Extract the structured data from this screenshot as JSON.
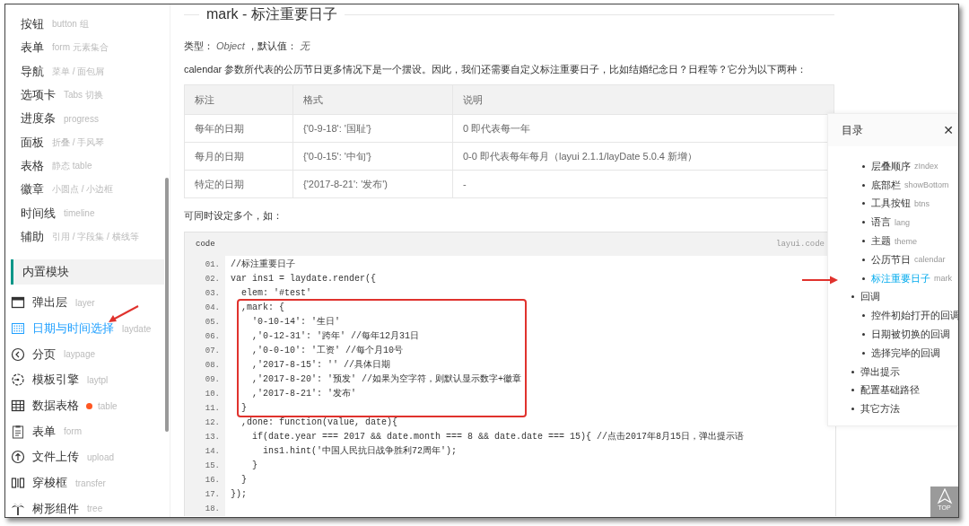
{
  "sidebar": {
    "items": [
      {
        "label": "按钮",
        "hint": "button 组",
        "selected": false
      },
      {
        "label": "表单",
        "hint": "form 元素集合",
        "selected": false
      },
      {
        "label": "导航",
        "hint": "菜单 / 面包屑",
        "selected": false
      },
      {
        "label": "选项卡",
        "hint": "Tabs 切换",
        "selected": false
      },
      {
        "label": "进度条",
        "hint": "progress",
        "selected": false
      },
      {
        "label": "面板",
        "hint": "折叠 / 手风琴",
        "selected": false
      },
      {
        "label": "表格",
        "hint": "静态 table",
        "selected": false
      },
      {
        "label": "徽章",
        "hint": "小圆点 / 小边框",
        "selected": false
      },
      {
        "label": "时间线",
        "hint": "timeline",
        "selected": false
      },
      {
        "label": "辅助",
        "hint": "引用 / 字段集 / 横线等",
        "selected": false
      }
    ],
    "section": "内置模块",
    "modules": [
      {
        "label": "弹出层",
        "hint": "layer",
        "selected": false,
        "badge": false
      },
      {
        "label": "日期与时间选择",
        "hint": "laydate",
        "selected": true,
        "badge": false
      },
      {
        "label": "分页",
        "hint": "laypage",
        "selected": false,
        "badge": false
      },
      {
        "label": "模板引擎",
        "hint": "laytpl",
        "selected": false,
        "badge": false
      },
      {
        "label": "数据表格",
        "hint": "table",
        "selected": false,
        "badge": true
      },
      {
        "label": "表单",
        "hint": "form",
        "selected": false,
        "badge": false
      },
      {
        "label": "文件上传",
        "hint": "upload",
        "selected": false,
        "badge": false
      },
      {
        "label": "穿梭框",
        "hint": "transfer",
        "selected": false,
        "badge": false
      },
      {
        "label": "树形组件",
        "hint": "tree",
        "selected": false,
        "badge": false
      }
    ]
  },
  "content": {
    "title": "mark - 标注重要日子",
    "type_label": "类型：",
    "type_value": "Object",
    "default_label": "，默认值：",
    "default_value": "无",
    "intro": "calendar 参数所代表的公历节日更多情况下是一个摆设。因此，我们还需要自定义标注重要日子，比如结婚纪念日？日程等？它分为以下两种：",
    "table": {
      "columns": [
        "标注",
        "格式",
        "说明"
      ],
      "rows": [
        [
          "每年的日期",
          "{'0-9-18': '国耻'}",
          "0 即代表每一年"
        ],
        [
          "每月的日期",
          "{'0-0-15': '中旬'}",
          "0-0 即代表每年每月（layui 2.1.1/layDate 5.0.4 新增）"
        ],
        [
          "特定的日期",
          "{'2017-8-21': '发布')",
          "-"
        ]
      ]
    },
    "note": "可同时设定多个，如：",
    "code": {
      "label": "code",
      "brand": "layui.code",
      "blocks": [
        {
          "boxed": false,
          "lines": [
            {
              "no": "01.",
              "text": "//标注重要日子"
            },
            {
              "no": "02.",
              "text": "var ins1 = laydate.render({"
            },
            {
              "no": "03.",
              "text": "  elem: '#test'"
            }
          ]
        },
        {
          "boxed": true,
          "lines": [
            {
              "no": "04.",
              "text": "  ,mark: {"
            },
            {
              "no": "05.",
              "text": "    '0-10-14': '生日'"
            },
            {
              "no": "06.",
              "text": "    ,'0-12-31': '跨年' //每年12月31日"
            },
            {
              "no": "07.",
              "text": "    ,'0-0-10': '工资' //每个月10号"
            },
            {
              "no": "08.",
              "text": "    ,'2017-8-15': '' //具体日期"
            },
            {
              "no": "09.",
              "text": "    ,'2017-8-20': '预发' //如果为空字符，则默认显示数字+徽章"
            },
            {
              "no": "10.",
              "text": "    ,'2017-8-21': '发布'"
            },
            {
              "no": "11.",
              "text": "  }"
            }
          ]
        },
        {
          "boxed": false,
          "lines": [
            {
              "no": "12.",
              "text": "  ,done: function(value, date){"
            },
            {
              "no": "13.",
              "text": "    if(date.year === 2017 && date.month === 8 && date.date === 15){ //点击2017年8月15日，弹出提示语"
            },
            {
              "no": "14.",
              "text": "      ins1.hint('中国人民抗日战争胜利72周年');"
            },
            {
              "no": "15.",
              "text": "    }"
            },
            {
              "no": "16.",
              "text": "  }"
            },
            {
              "no": "17.",
              "text": "});"
            },
            {
              "no": "18."
            }
          ]
        }
      ]
    }
  },
  "toc": {
    "title": "目录",
    "close": "✕",
    "items": [
      {
        "children": [
          {
            "label": "层叠顺序",
            "hint": "zIndex",
            "selected": false
          },
          {
            "label": "底部栏",
            "hint": "showBottom",
            "selected": false
          },
          {
            "label": "工具按钮",
            "hint": "btns",
            "selected": false
          },
          {
            "label": "语言",
            "hint": "lang",
            "selected": false
          },
          {
            "label": "主题",
            "hint": "theme",
            "selected": false
          },
          {
            "label": "公历节日",
            "hint": "calendar",
            "selected": false
          },
          {
            "label": "标注重要日子",
            "hint": "mark",
            "selected": true
          }
        ]
      },
      {
        "label": "回调",
        "selected": false,
        "children": [
          {
            "label": "控件初始打开的回调",
            "selected": false
          },
          {
            "label": "日期被切换的回调",
            "selected": false
          },
          {
            "label": "选择完毕的回调",
            "selected": false
          }
        ]
      },
      {
        "label": "弹出提示",
        "selected": false
      },
      {
        "label": "配置基础路径",
        "selected": false
      },
      {
        "label": "其它方法",
        "selected": false
      }
    ]
  },
  "top_button": "TOP"
}
